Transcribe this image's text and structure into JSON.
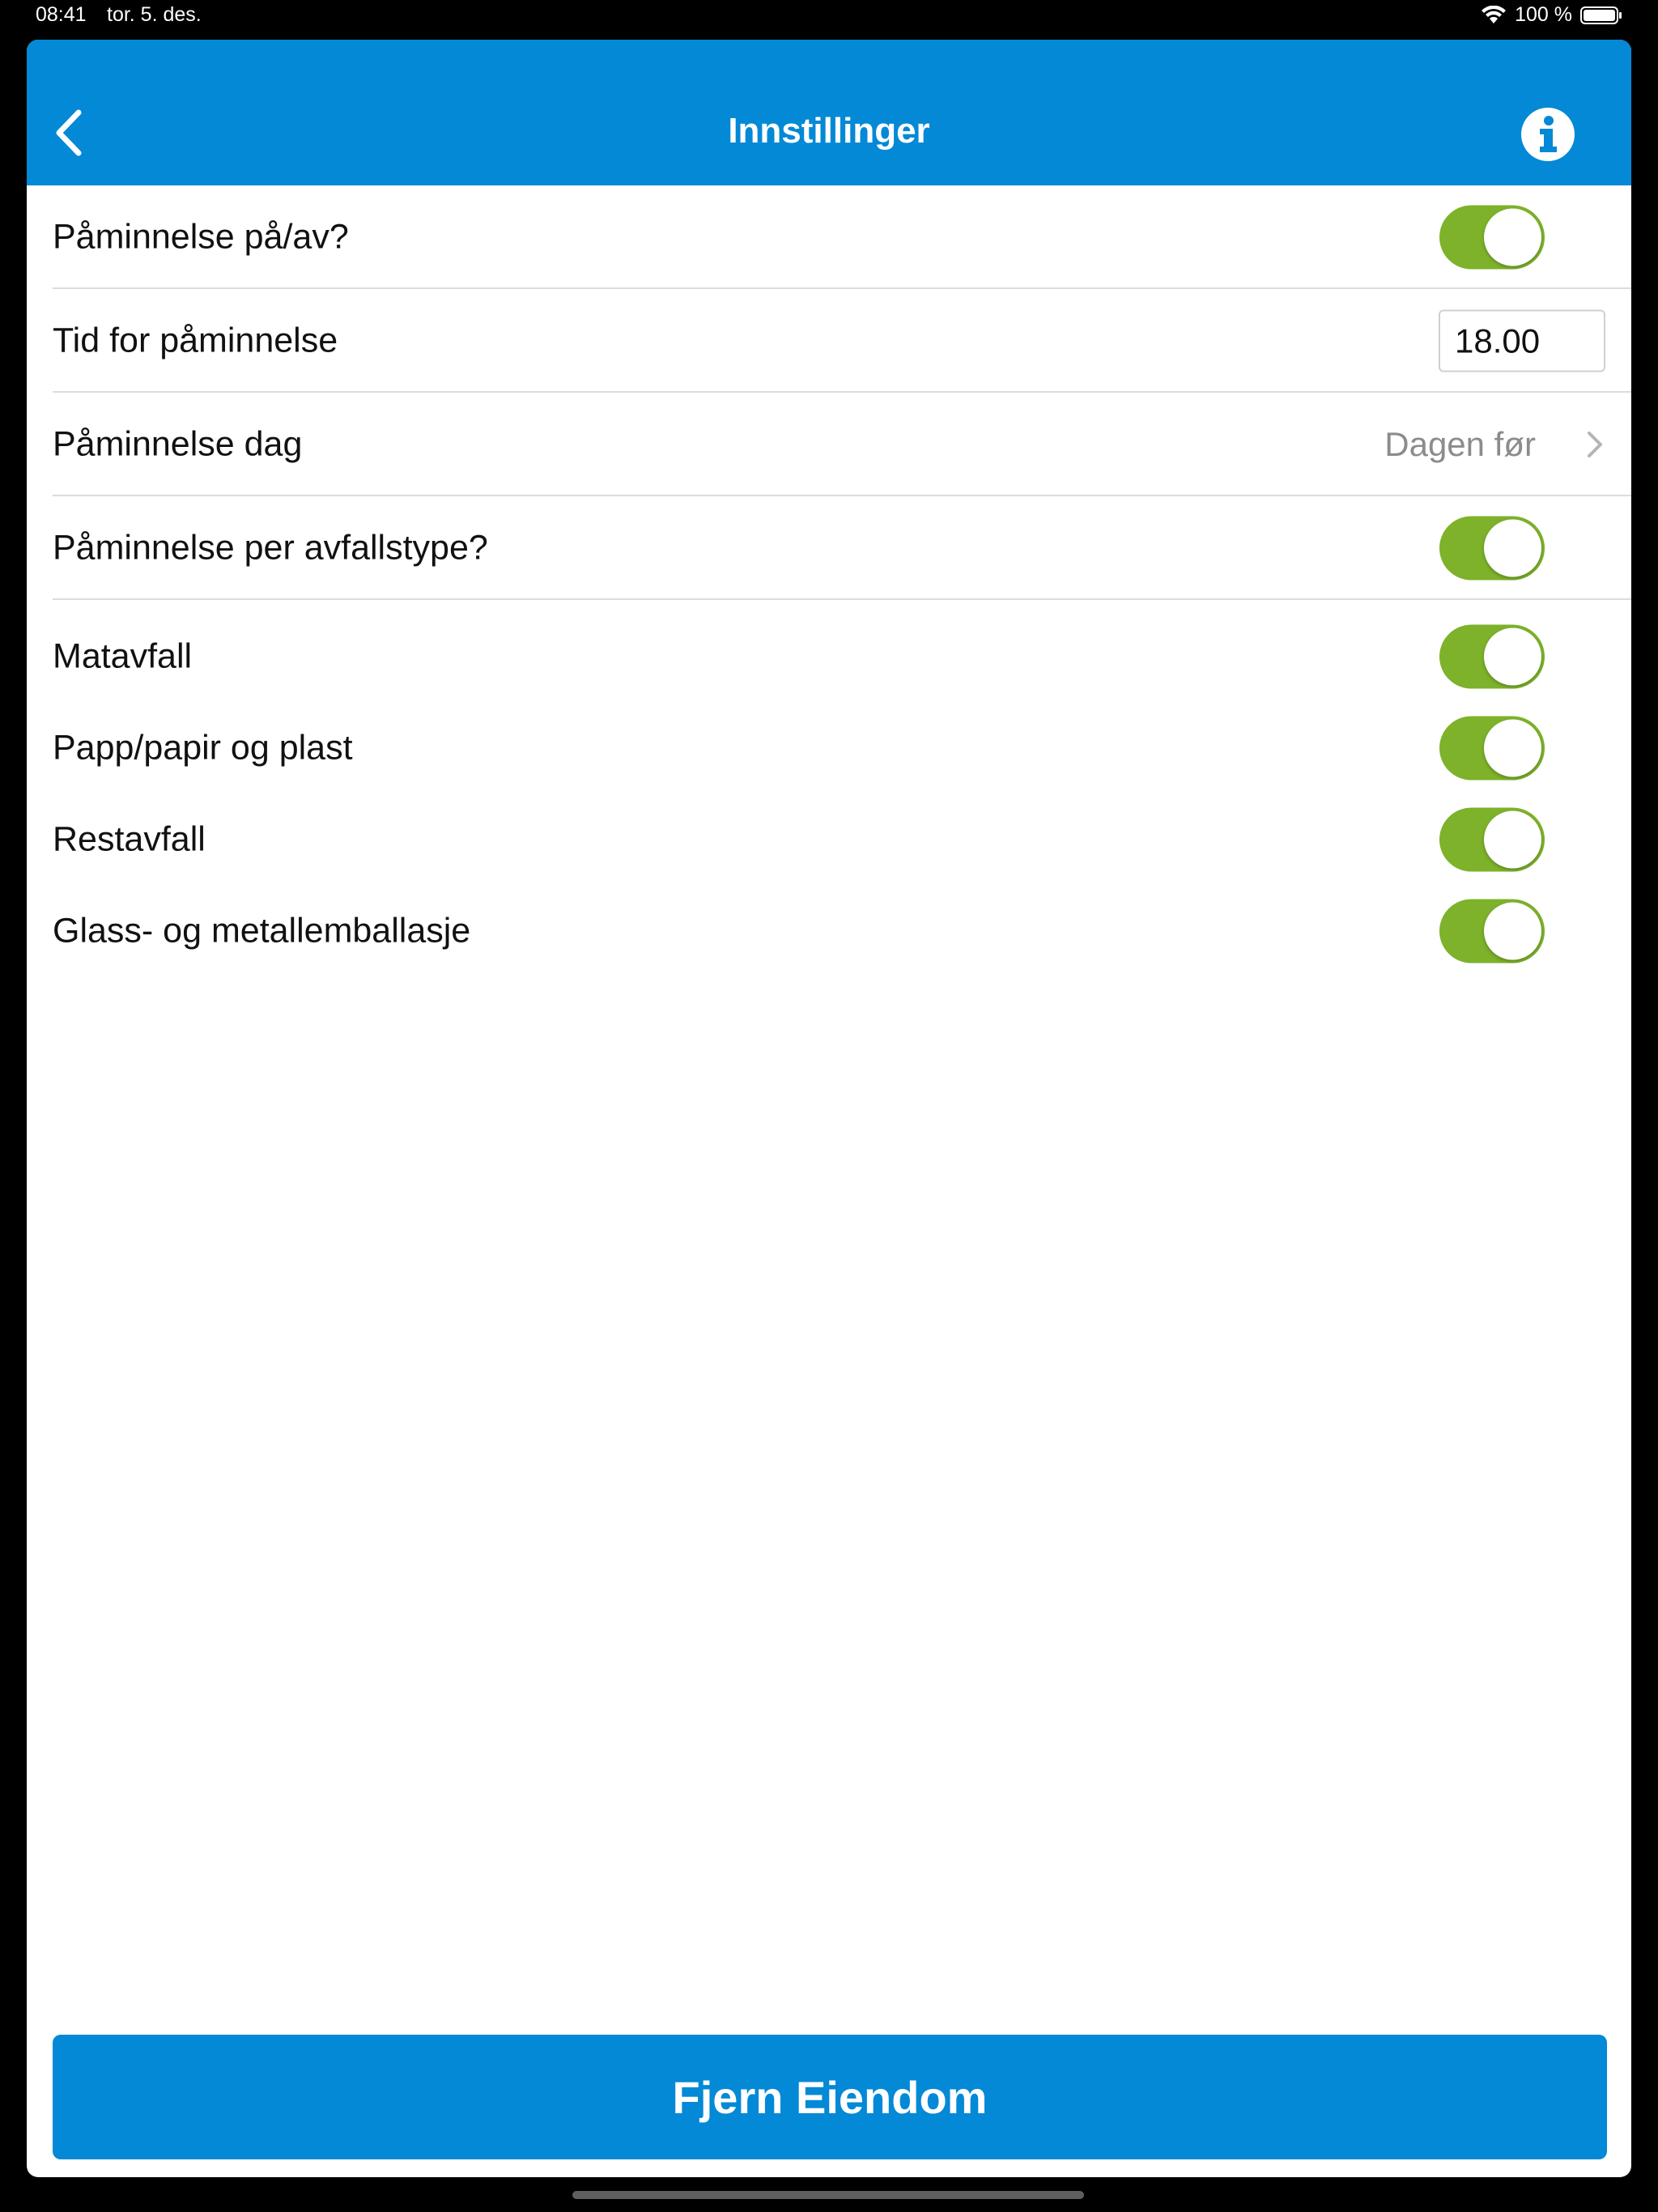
{
  "status_bar": {
    "time": "08:41",
    "date": "tor. 5. des.",
    "battery_text": "100 %",
    "icons": [
      "wifi-icon",
      "battery-icon"
    ]
  },
  "header": {
    "title": "Innstillinger",
    "back_icon": "chevron-left-icon",
    "info_icon": "info-icon"
  },
  "settings": {
    "reminder_toggle": {
      "label": "Påminnelse på/av?",
      "on": true
    },
    "reminder_time": {
      "label": "Tid for påminnelse",
      "value": "18.00"
    },
    "reminder_day": {
      "label": "Påminnelse dag",
      "value": "Dagen før"
    },
    "per_type_toggle": {
      "label": "Påminnelse per avfallstype?",
      "on": true
    },
    "waste_types": [
      {
        "label": "Matavfall",
        "on": true
      },
      {
        "label": "Papp/papir og plast",
        "on": true
      },
      {
        "label": "Restavfall",
        "on": true
      },
      {
        "label": "Glass- og metallemballasje",
        "on": true
      }
    ]
  },
  "footer": {
    "remove_label": "Fjern Eiendom"
  },
  "colors": {
    "brand_blue": "#0389d6",
    "toggle_green": "#7db22a",
    "secondary_text": "#8c8c8c"
  }
}
